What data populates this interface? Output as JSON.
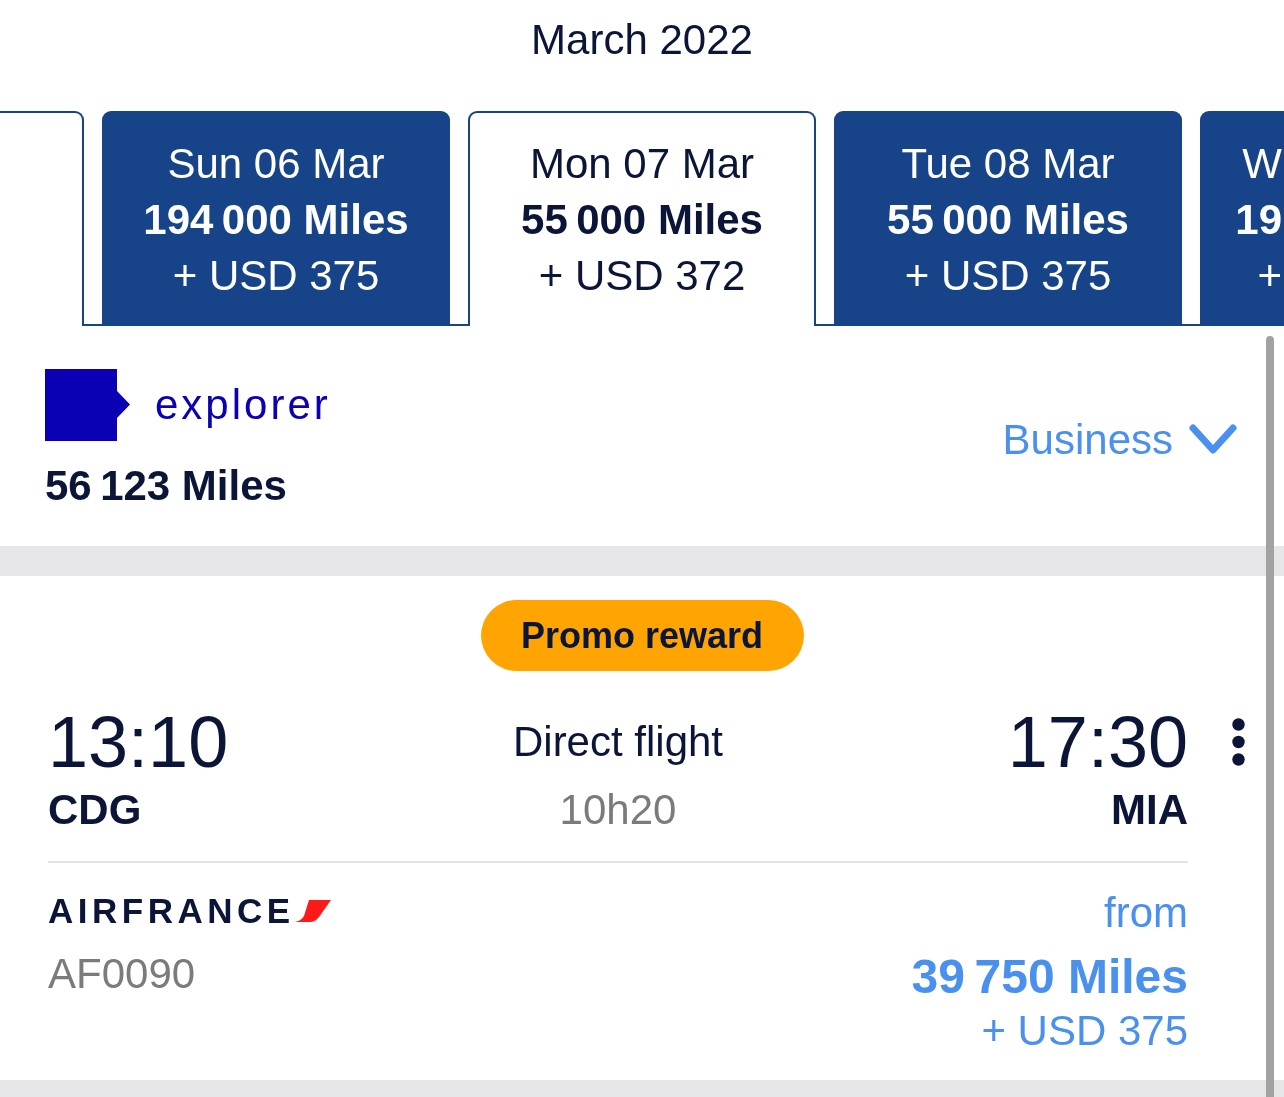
{
  "header": {
    "title": "March 2022"
  },
  "date_tabs": [
    {
      "kind": "blank",
      "selected": false
    },
    {
      "kind": "fare",
      "selected": false,
      "date": "Sun 06 Mar",
      "miles": "194 000 Miles",
      "price": "+ USD 375"
    },
    {
      "kind": "fare",
      "selected": true,
      "date": "Mon 07 Mar",
      "miles": "55 000 Miles",
      "price": "+ USD 372"
    },
    {
      "kind": "fare",
      "selected": false,
      "date": "Tue 08 Mar",
      "miles": "55 000 Miles",
      "price": "+ USD 375"
    },
    {
      "kind": "cut",
      "selected": false,
      "date": "W",
      "miles": "19",
      "price": "+"
    }
  ],
  "account": {
    "tier": "explorer",
    "miles": "56 123 Miles",
    "cabin": "Business"
  },
  "flight": {
    "badge": "Promo reward",
    "departure": {
      "time": "13:10",
      "airport": "CDG"
    },
    "stops": "Direct flight",
    "duration": "10h20",
    "arrival": {
      "time": "17:30",
      "airport": "MIA"
    },
    "airline": "AIRFRANCE",
    "flight_number": "AF0090",
    "price_prefix": "from",
    "miles": "39 750 Miles",
    "price": "+ USD 375"
  }
}
